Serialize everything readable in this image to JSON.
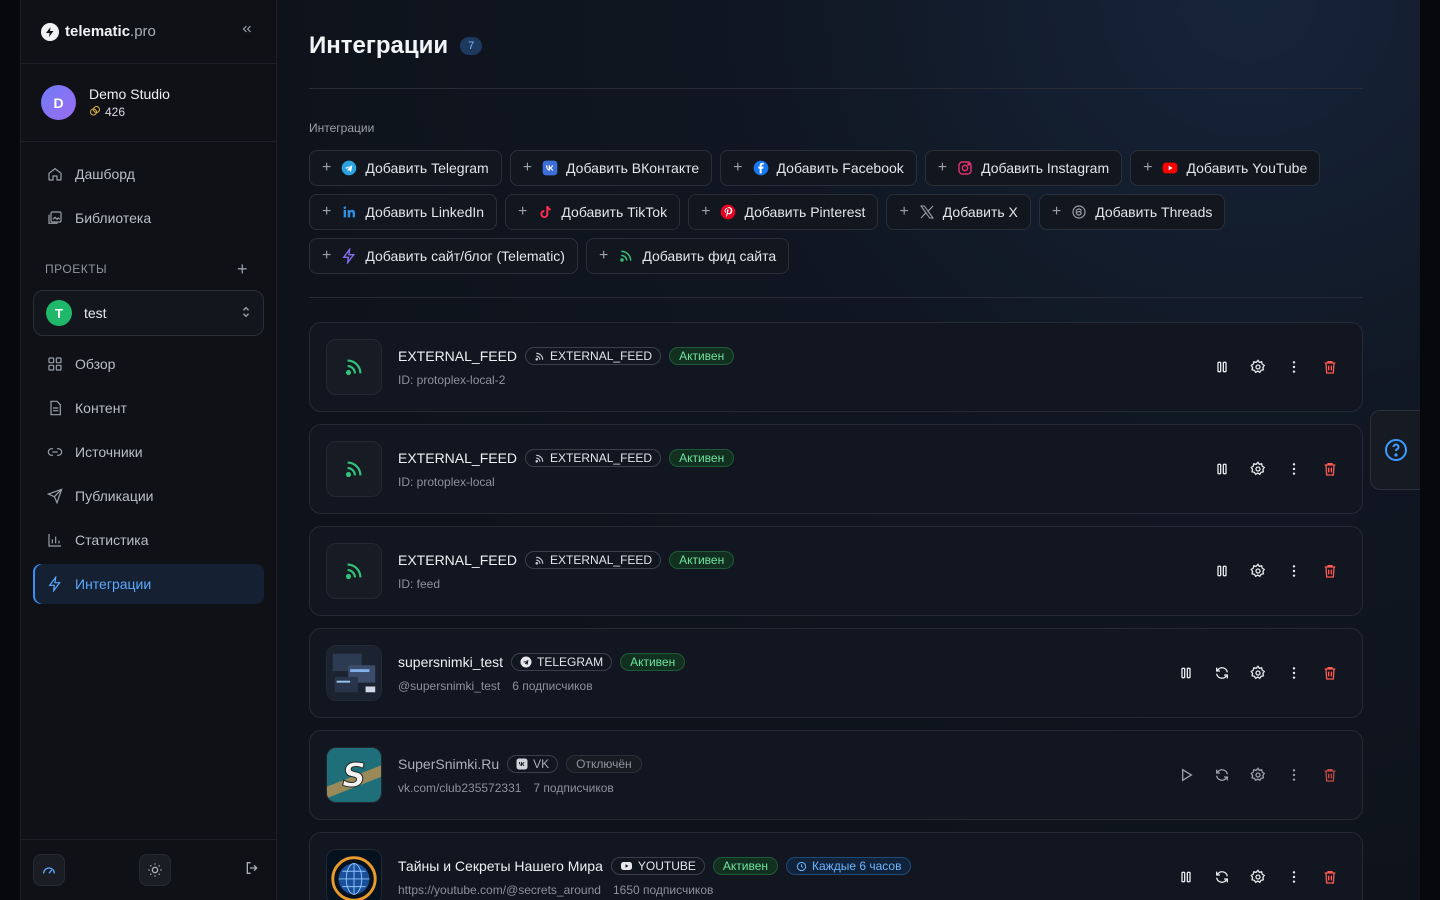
{
  "brand": {
    "name": "telematic",
    "suffix": ".pro"
  },
  "studio": {
    "initial": "D",
    "name": "Demo Studio",
    "credits": "426"
  },
  "nav_top": [
    {
      "label": "Дашборд",
      "icon": "home-icon"
    },
    {
      "label": "Библиотека",
      "icon": "image-library-icon"
    }
  ],
  "projects": {
    "heading": "ПРОЕКТЫ",
    "current": {
      "initial": "T",
      "name": "test"
    }
  },
  "nav_project": [
    {
      "label": "Обзор",
      "icon": "grid-icon"
    },
    {
      "label": "Контент",
      "icon": "document-icon"
    },
    {
      "label": "Источники",
      "icon": "link-icon"
    },
    {
      "label": "Публикации",
      "icon": "send-icon"
    },
    {
      "label": "Статистика",
      "icon": "bar-chart-icon"
    },
    {
      "label": "Интеграции",
      "icon": "bolt-icon",
      "active": true
    }
  ],
  "page": {
    "title": "Интеграции",
    "count": "7",
    "section_label": "Интеграции"
  },
  "add_buttons": [
    {
      "label": "Добавить Telegram",
      "icon": "telegram-icon",
      "color": "#2aa3e0"
    },
    {
      "label": "Добавить ВКонтакте",
      "icon": "vk-icon",
      "color": "#3d6fd6"
    },
    {
      "label": "Добавить Facebook",
      "icon": "facebook-icon",
      "color": "#1877f2"
    },
    {
      "label": "Добавить Instagram",
      "icon": "instagram-icon",
      "color": "#e1306c"
    },
    {
      "label": "Добавить YouTube",
      "icon": "youtube-icon",
      "color": "#ff0000"
    },
    {
      "label": "Добавить LinkedIn",
      "icon": "linkedin-icon",
      "color": "#2d8fe0"
    },
    {
      "label": "Добавить TikTok",
      "icon": "tiktok-icon",
      "color": "#ff2d55"
    },
    {
      "label": "Добавить Pinterest",
      "icon": "pinterest-icon",
      "color": "#e60023"
    },
    {
      "label": "Добавить X",
      "icon": "x-icon",
      "color": "#9aa0ab"
    },
    {
      "label": "Добавить Threads",
      "icon": "threads-icon",
      "color": "#9aa0ab"
    },
    {
      "label": "Добавить сайт/блог (Telematic)",
      "icon": "bolt-icon",
      "color": "#8b6cf6"
    },
    {
      "label": "Добавить фид сайта",
      "icon": "rss-icon",
      "color": "#33c27a"
    }
  ],
  "integrations": [
    {
      "name": "EXTERNAL_FEED",
      "tag": "EXTERNAL_FEED",
      "status": "Активен",
      "active": true,
      "meta": [
        "ID: protoplex-local-2"
      ],
      "thumb": "rss"
    },
    {
      "name": "EXTERNAL_FEED",
      "tag": "EXTERNAL_FEED",
      "status": "Активен",
      "active": true,
      "meta": [
        "ID: protoplex-local"
      ],
      "thumb": "rss"
    },
    {
      "name": "EXTERNAL_FEED",
      "tag": "EXTERNAL_FEED",
      "status": "Активен",
      "active": true,
      "meta": [
        "ID: feed"
      ],
      "thumb": "rss"
    },
    {
      "name": "supersnimki_test",
      "tag": "TELEGRAM",
      "status": "Активен",
      "active": true,
      "meta": [
        "@supersnimki_test",
        "6 подписчиков"
      ],
      "thumb": "screens",
      "sync": true
    },
    {
      "name": "SuperSnimki.Ru",
      "tag": "VK",
      "status": "Отключён",
      "active": false,
      "meta": [
        "vk.com/club235572331",
        "7 подписчиков"
      ],
      "thumb": "s-logo",
      "sync": true
    },
    {
      "name": "Тайны и Секреты Нашего Мира",
      "tag": "YOUTUBE",
      "status": "Активен",
      "active": true,
      "schedule": "Каждые 6 часов",
      "meta": [
        "https://youtube.com/@secrets_around",
        "1650 подписчиков"
      ],
      "thumb": "globe",
      "sync": true
    }
  ],
  "colors": {
    "accent": "#3c8ef5",
    "active_status": "#6fe3a0",
    "danger": "#ff5a52"
  }
}
